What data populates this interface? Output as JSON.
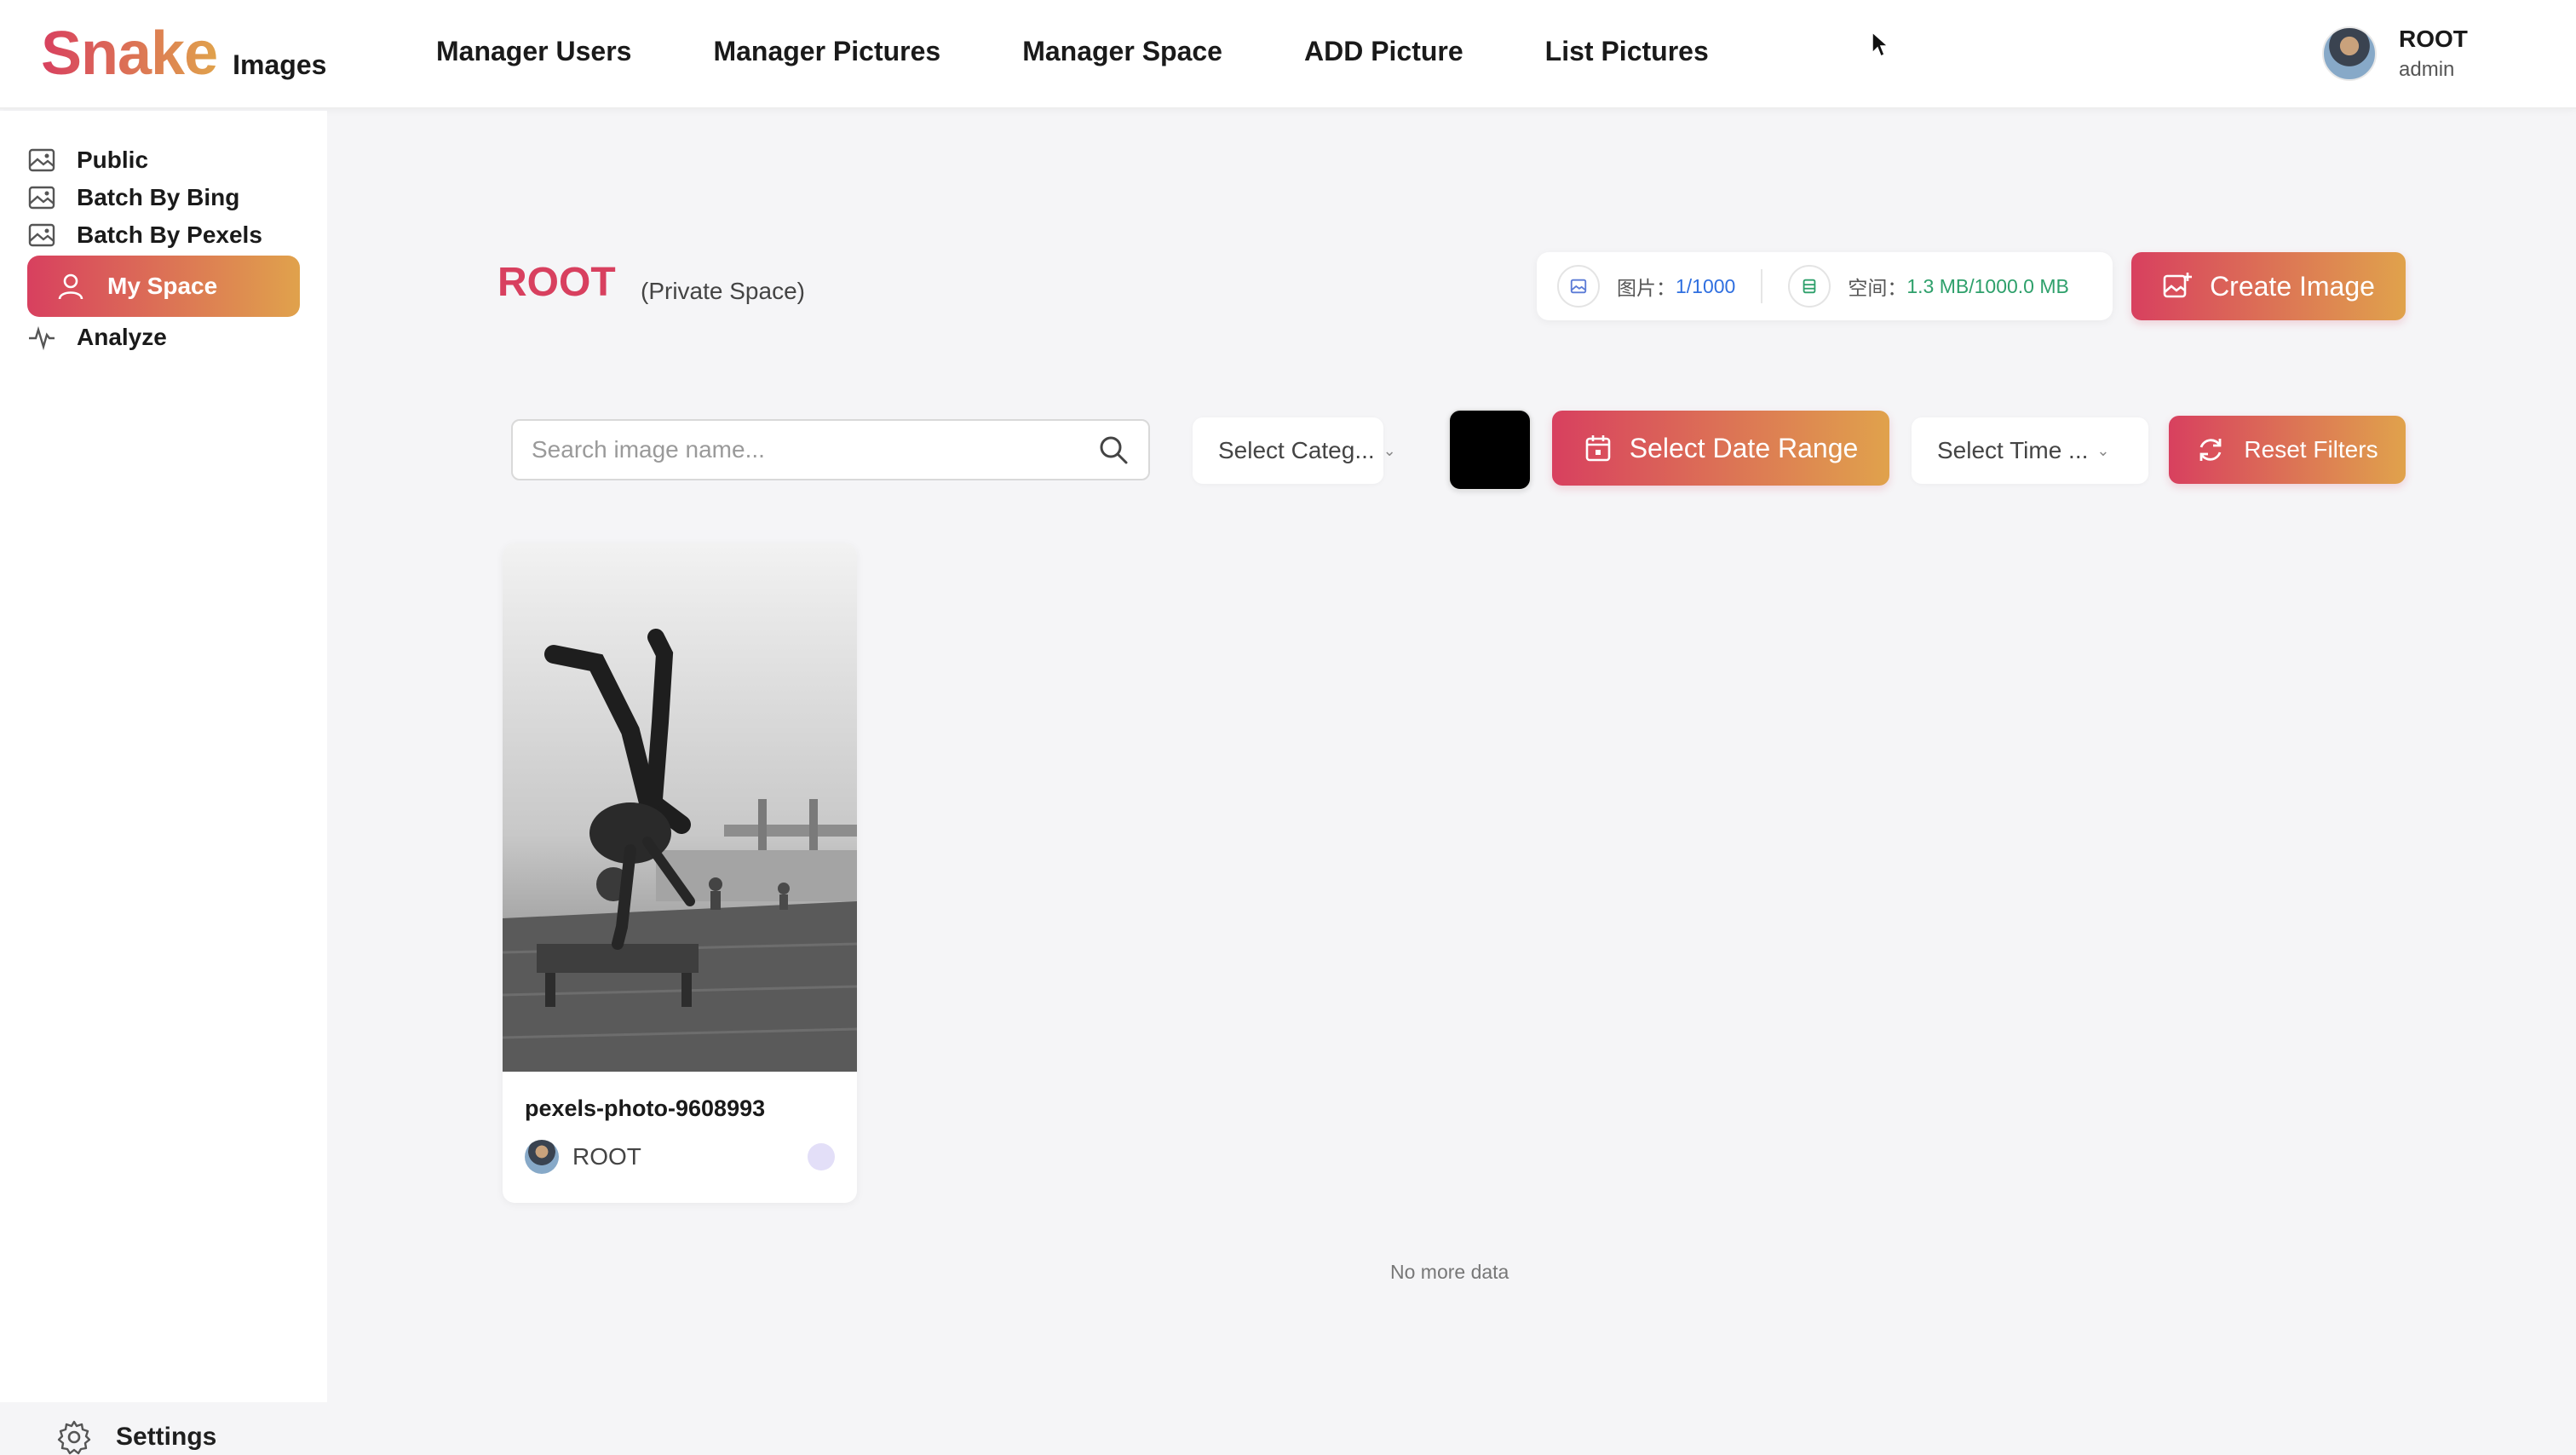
{
  "header": {
    "logo_main": "Snake",
    "logo_sub": "Images",
    "nav": [
      {
        "label": "Manager Users"
      },
      {
        "label": "Manager Pictures"
      },
      {
        "label": "Manager Space"
      },
      {
        "label": "ADD Picture"
      },
      {
        "label": "List Pictures"
      }
    ],
    "user": {
      "name": "ROOT",
      "role": "admin"
    }
  },
  "sidebar": {
    "items": [
      {
        "label": "Public",
        "icon": "image-icon"
      },
      {
        "label": "Batch By Bing",
        "icon": "image-icon"
      },
      {
        "label": "Batch By Pexels",
        "icon": "image-icon"
      },
      {
        "label": "My Space",
        "icon": "user-icon",
        "active": true
      },
      {
        "label": "Analyze",
        "icon": "pulse-icon"
      }
    ],
    "settings_label": "Settings"
  },
  "space": {
    "title": "ROOT",
    "subtitle": "(Private Space)",
    "stats": {
      "pictures_label": "图片：",
      "pictures_value": "1/1000",
      "space_label": "空间：",
      "space_value": "1.3 MB/1000.0 MB"
    },
    "create_button": "Create Image"
  },
  "filters": {
    "search_placeholder": "Search image name...",
    "category_select": "Select Categ...",
    "color_value": "#000000",
    "date_button": "Select Date Range",
    "time_select": "Select Time ...",
    "reset_button": "Reset Filters"
  },
  "pictures": [
    {
      "title": "pexels-photo-9608993",
      "user": "ROOT"
    }
  ],
  "footer_text": "No more data",
  "colors": {
    "accent_start": "#d8405f",
    "accent_end": "#e0a24c",
    "stat_blue": "#2f6fe0",
    "stat_green": "#2ea06b"
  }
}
